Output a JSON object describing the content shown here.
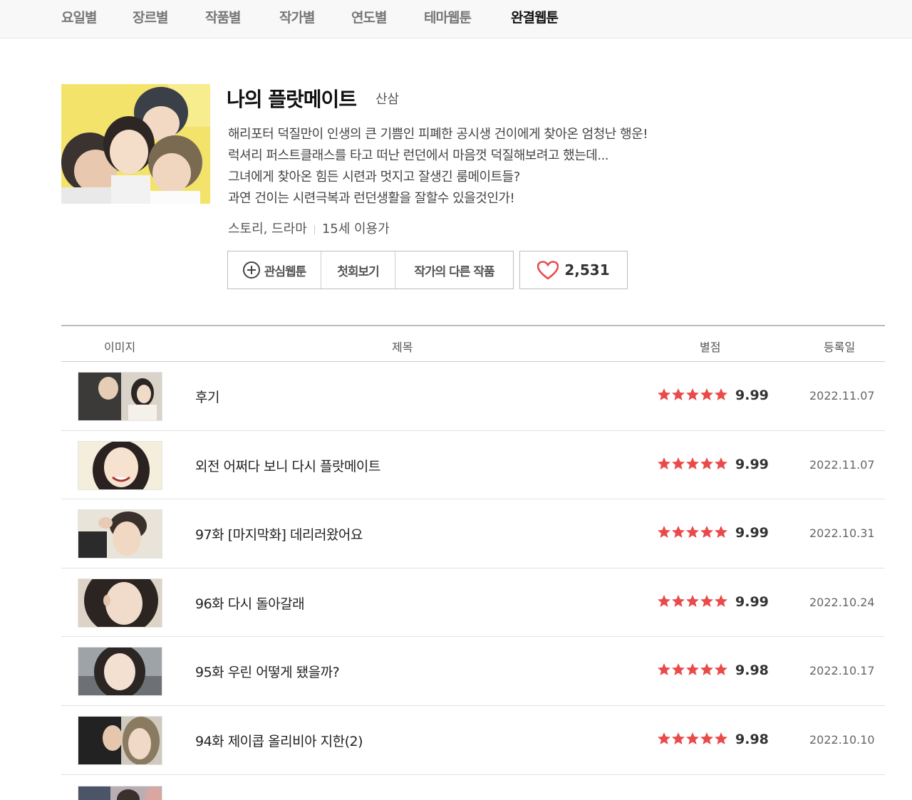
{
  "nav": {
    "tabs": [
      {
        "label": "요일별"
      },
      {
        "label": "장르별"
      },
      {
        "label": "작품별"
      },
      {
        "label": "작가별"
      },
      {
        "label": "연도별"
      },
      {
        "label": "테마웹툰"
      },
      {
        "label": "완결웹툰",
        "active": true
      }
    ]
  },
  "comic": {
    "title": "나의 플랏메이트",
    "author": "산삼",
    "synopsis": [
      "해리포터 덕질만이 인생의 큰 기쁨인 피폐한 공시생 건이에게 찾아온 엄청난 행운!",
      "럭셔리 퍼스트클래스를 타고 떠난 런던에서 마음껏 덕질해보려고 했는데...",
      "그녀에게 찾아온 힘든 시련과 멋지고 잘생긴 룸메이트들?",
      "과연 건이는 시련극복과 런던생활을 잘할수 있을것인가!"
    ],
    "genre": "스토리, 드라마",
    "age": "15세 이용가",
    "buttons": {
      "favorite": "관심웹툰",
      "first_episode": "첫회보기",
      "other_works": "작가의 다른 작품"
    },
    "likes": "2,531"
  },
  "table": {
    "headers": {
      "image": "이미지",
      "title": "제목",
      "rating": "별점",
      "date": "등록일"
    },
    "rows": [
      {
        "title": "후기",
        "rating": "9.99",
        "date": "2022.11.07"
      },
      {
        "title": "외전 어쩌다 보니 다시 플랏메이트",
        "rating": "9.99",
        "date": "2022.11.07"
      },
      {
        "title": "97화 [마지막화] 데리러왔어요",
        "rating": "9.99",
        "date": "2022.10.31"
      },
      {
        "title": "96화 다시 돌아갈래",
        "rating": "9.99",
        "date": "2022.10.24"
      },
      {
        "title": "95화 우린 어떻게 됐을까?",
        "rating": "9.98",
        "date": "2022.10.17"
      },
      {
        "title": "94화 제이콥 올리비아 지한(2)",
        "rating": "9.98",
        "date": "2022.10.10"
      }
    ]
  },
  "colors": {
    "star": "#e94b4b",
    "heart": "#e94b4b",
    "nav_bg": "#f8f8f8"
  }
}
